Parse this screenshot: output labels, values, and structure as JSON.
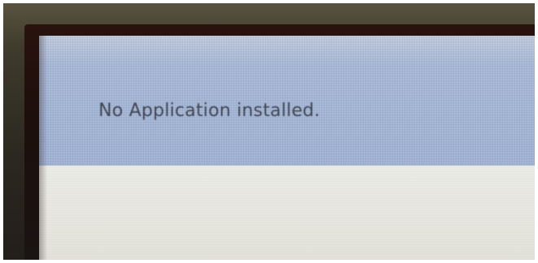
{
  "screen": {
    "message": "No Application installed.",
    "banner_color": "#a6b7d7",
    "content_color": "#e8e7e0"
  }
}
